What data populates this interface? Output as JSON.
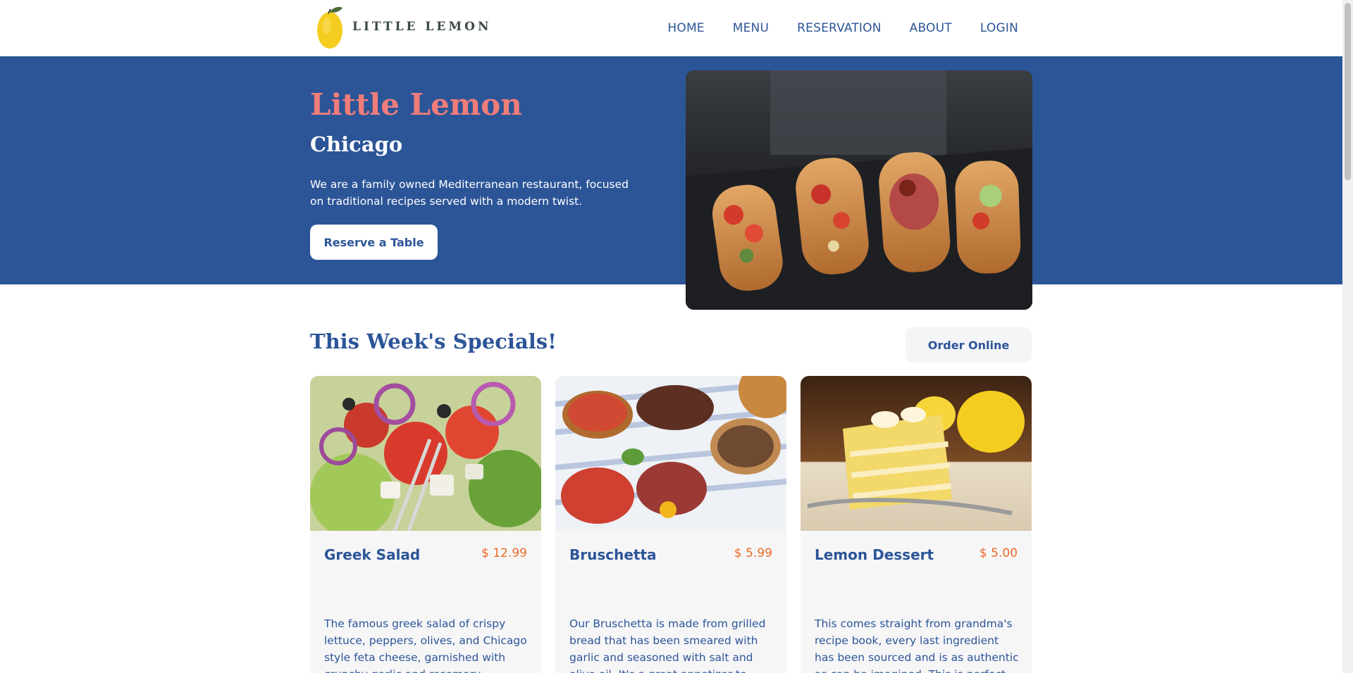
{
  "brand": {
    "name": "LITTLE LEMON"
  },
  "nav": {
    "items": [
      {
        "label": "HOME"
      },
      {
        "label": "MENU"
      },
      {
        "label": "RESERVATION"
      },
      {
        "label": "ABOUT"
      },
      {
        "label": "LOGIN"
      }
    ]
  },
  "hero": {
    "title": "Little Lemon",
    "subtitle": "Chicago",
    "description": "We are a family owned Mediterranean restaurant, focused on traditional recipes served with a modern twist.",
    "cta_label": "Reserve a Table"
  },
  "specials": {
    "title": "This Week's Specials!",
    "order_label": "Order Online",
    "cards": [
      {
        "name": "Greek Salad",
        "price": "$ 12.99",
        "description": "The famous greek salad of crispy lettuce, peppers, olives, and Chicago style feta cheese, garnished with crunchy garlic and rosemary croutons."
      },
      {
        "name": "Bruschetta",
        "price": "$ 5.99",
        "description": "Our Bruschetta is made from grilled bread that has been smeared with garlic and seasoned with salt and olive oil. It's a great appetizer to start with!"
      },
      {
        "name": "Lemon Dessert",
        "price": "$ 5.00",
        "description": "This comes straight from grandma's recipe book, every last ingredient has been sourced and is as authentic as can be imagined. This is perfect for a"
      }
    ]
  },
  "colors": {
    "primary": "#2c5598",
    "accent": "#f07d7a",
    "price": "#ee6a26",
    "lemon": "#f4cd20"
  }
}
